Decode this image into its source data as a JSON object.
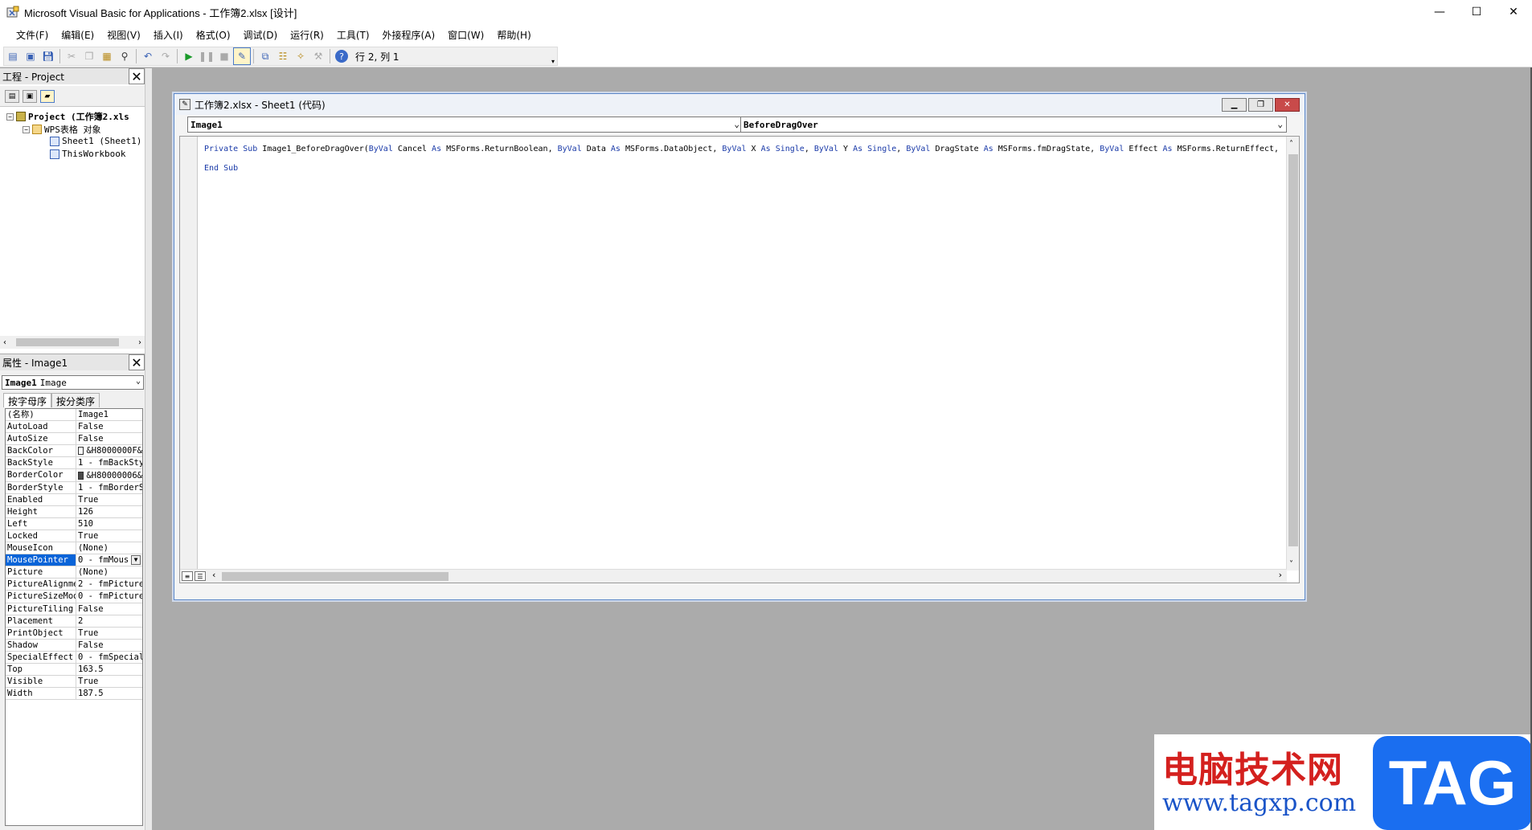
{
  "window": {
    "title": "Microsoft Visual Basic for Applications - 工作簿2.xlsx [设计]",
    "controls": {
      "minimize": "—",
      "maximize": "☐",
      "close": "✕"
    }
  },
  "menu": [
    "文件(F)",
    "编辑(E)",
    "视图(V)",
    "插入(I)",
    "格式(O)",
    "调试(D)",
    "运行(R)",
    "工具(T)",
    "外接程序(A)",
    "窗口(W)",
    "帮助(H)"
  ],
  "toolbar": {
    "position_text": "行 2, 列 1",
    "icons": [
      "excel-view-icon",
      "insert-form-icon",
      "save-icon",
      "cut-icon",
      "copy-icon",
      "paste-icon",
      "find-icon",
      "undo-icon",
      "redo-icon",
      "run-icon",
      "break-icon",
      "reset-icon",
      "design-mode-icon",
      "project-explorer-icon",
      "properties-icon",
      "object-browser-icon",
      "toolbox-icon",
      "help-icon"
    ]
  },
  "project_pane": {
    "title": "工程 - Project",
    "tree": [
      {
        "label": "Project (工作簿2.xls",
        "bold": true
      },
      {
        "label": "WPS表格 对象"
      },
      {
        "label": "Sheet1 (Sheet1)"
      },
      {
        "label": "ThisWorkbook"
      }
    ]
  },
  "properties_pane": {
    "title": "属性 - Image1",
    "object_name": "Image1",
    "object_type": "Image",
    "tabs": [
      "按字母序",
      "按分类序"
    ],
    "rows": [
      {
        "name": "(名称)",
        "value": "Image1"
      },
      {
        "name": "AutoLoad",
        "value": "False"
      },
      {
        "name": "AutoSize",
        "value": "False"
      },
      {
        "name": "BackColor",
        "value": "&H8000000F&",
        "swatch": "#ffffff"
      },
      {
        "name": "BackStyle",
        "value": "1 - fmBackSty"
      },
      {
        "name": "BorderColor",
        "value": "&H80000006&",
        "swatch": "#4a4a4a"
      },
      {
        "name": "BorderStyle",
        "value": "1 - fmBorderS"
      },
      {
        "name": "Enabled",
        "value": "True"
      },
      {
        "name": "Height",
        "value": "126"
      },
      {
        "name": "Left",
        "value": "510"
      },
      {
        "name": "Locked",
        "value": "True"
      },
      {
        "name": "MouseIcon",
        "value": "(None)"
      },
      {
        "name": "MousePointer",
        "value": "0 - fmMous",
        "selected": true
      },
      {
        "name": "Picture",
        "value": "(None)"
      },
      {
        "name": "PictureAlignme",
        "value": "2 - fmPicture"
      },
      {
        "name": "PictureSizeMod",
        "value": "0 - fmPicture"
      },
      {
        "name": "PictureTiling",
        "value": "False"
      },
      {
        "name": "Placement",
        "value": "2"
      },
      {
        "name": "PrintObject",
        "value": "True"
      },
      {
        "name": "Shadow",
        "value": "False"
      },
      {
        "name": "SpecialEffect",
        "value": "0 - fmSpecial"
      },
      {
        "name": "Top",
        "value": "163.5"
      },
      {
        "name": "Visible",
        "value": "True"
      },
      {
        "name": "Width",
        "value": "187.5"
      }
    ]
  },
  "code_window": {
    "title": "工作簿2.xlsx - Sheet1 (代码)",
    "object_combo": "Image1",
    "proc_combo": "BeforeDragOver",
    "lines": [
      "Private Sub Image1_BeforeDragOver(ByVal Cancel As MSForms.ReturnBoolean, ByVal Data As MSForms.DataObject, ByVal X As Single, ByVal Y As Single, ByVal DragState As MSForms.fmDragState, ByVal Effect As MSForms.ReturnEffect,",
      "End Sub"
    ]
  },
  "watermark": {
    "cn_text": "电脑技术网",
    "url": "www.tagxp.com",
    "tag": "TAG"
  }
}
